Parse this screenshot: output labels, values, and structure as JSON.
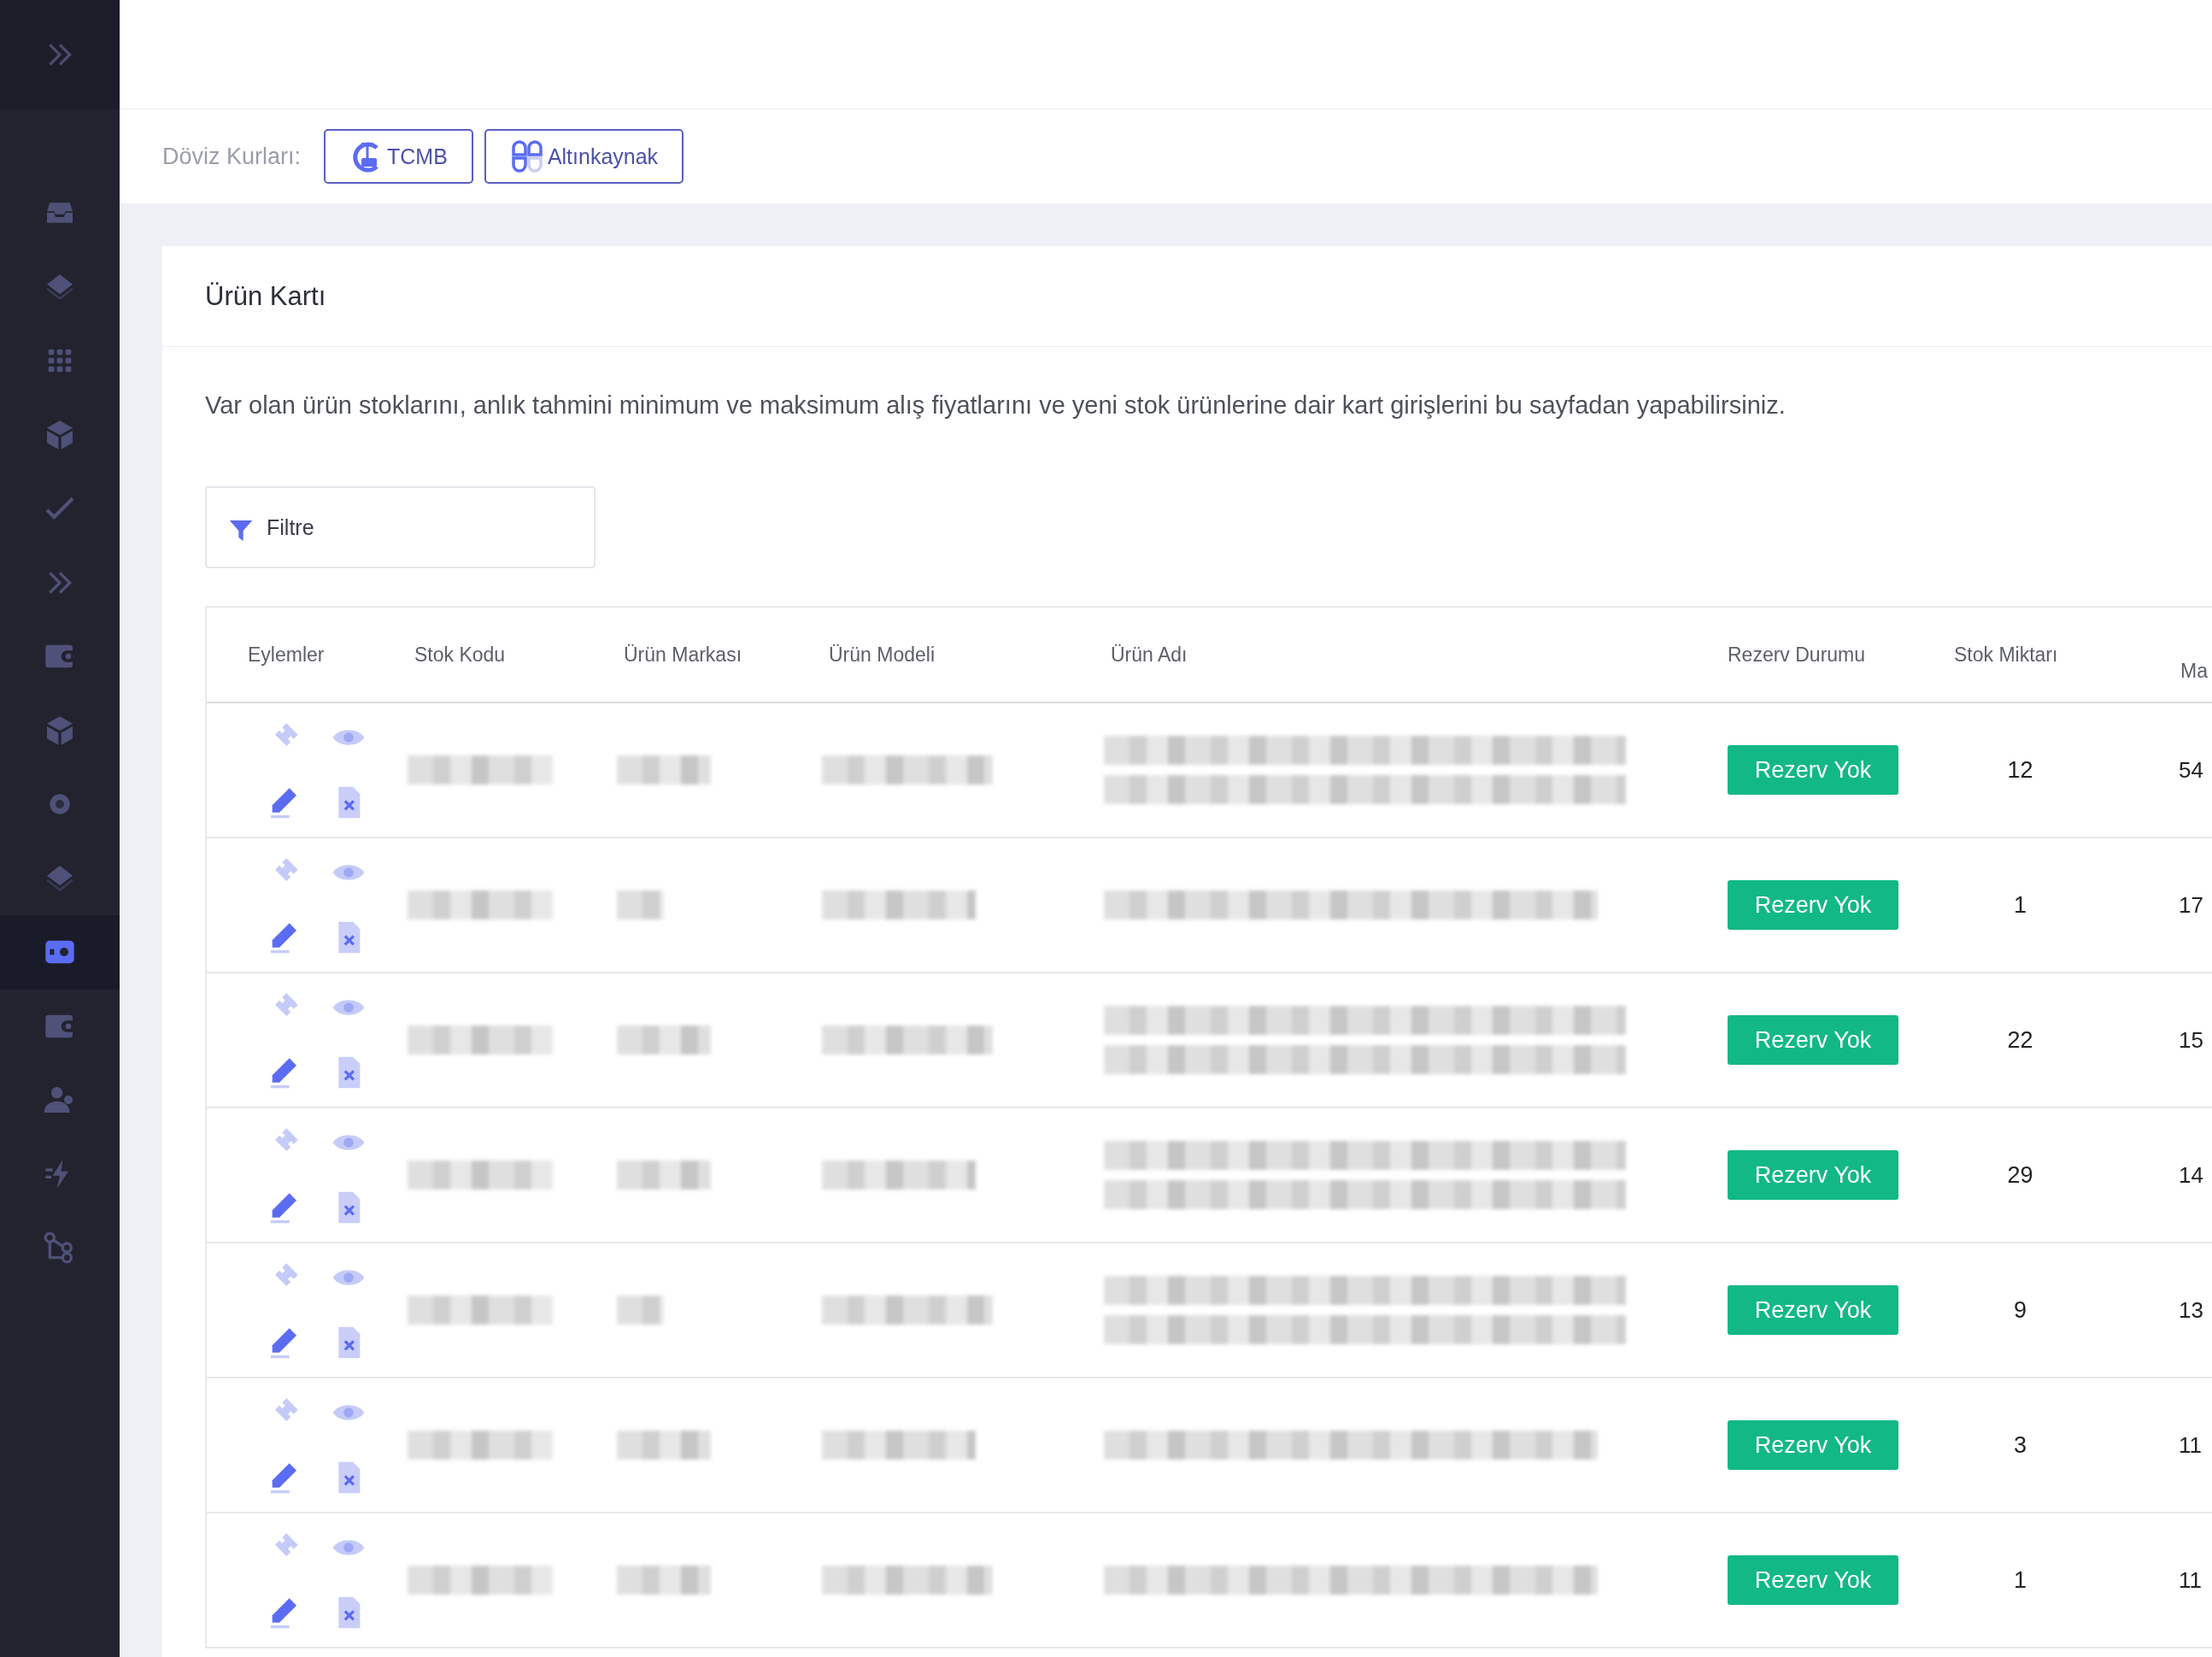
{
  "sidebar": {
    "items": [
      {
        "selected": false
      },
      {
        "selected": false
      },
      {
        "selected": false
      },
      {
        "selected": false
      },
      {
        "selected": false
      },
      {
        "selected": false
      },
      {
        "selected": false
      },
      {
        "selected": false
      },
      {
        "selected": false
      },
      {
        "selected": false
      },
      {
        "selected": true
      },
      {
        "selected": false
      },
      {
        "selected": false
      },
      {
        "selected": false
      },
      {
        "selected": false
      }
    ]
  },
  "toolbar": {
    "label": "Döviz Kurları:",
    "buttons": [
      {
        "label": "TCMB"
      },
      {
        "label": "Altınkaynak"
      }
    ]
  },
  "card": {
    "title": "Ürün Kartı",
    "description": "Var olan ürün stoklarını, anlık tahmini minimum ve maksimum alış fiyatlarını ve yeni stok ürünlerine dair kart girişlerini bu sayfadan yapabilirsiniz.",
    "filter": {
      "label": "Filtre"
    }
  },
  "table": {
    "columns": [
      "Eylemler",
      "Stok Kodu",
      "Ürün Markası",
      "Ürün Modeli",
      "Ürün Adı",
      "Rezerv Durumu",
      "Stok Miktarı",
      "Ma"
    ],
    "rows": [
      {
        "rezerv": "Rezerv Yok",
        "stok": "12",
        "column_8": "54"
      },
      {
        "rezerv": "Rezerv Yok",
        "stok": "1",
        "column_8": "17"
      },
      {
        "rezerv": "Rezerv Yok",
        "stok": "22",
        "column_8": "15"
      },
      {
        "rezerv": "Rezerv Yok",
        "stok": "29",
        "column_8": "14"
      },
      {
        "rezerv": "Rezerv Yok",
        "stok": "9",
        "column_8": "13"
      },
      {
        "rezerv": "Rezerv Yok",
        "stok": "3",
        "column_8": "11"
      },
      {
        "rezerv": "Rezerv Yok",
        "stok": "1",
        "column_8": "11"
      }
    ]
  }
}
